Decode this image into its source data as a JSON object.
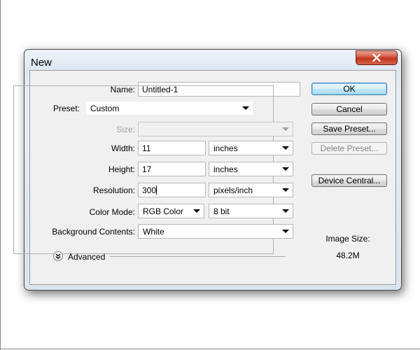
{
  "dialog": {
    "title": "New",
    "fields": {
      "name_label": "Name:",
      "name_value": "Untitled-1",
      "preset_label": "Preset:",
      "preset_value": "Custom",
      "size_label": "Size:",
      "size_value": "",
      "width_label": "Width:",
      "width_value": "11",
      "width_unit": "inches",
      "height_label": "Height:",
      "height_value": "17",
      "height_unit": "inches",
      "resolution_label": "Resolution:",
      "resolution_value": "300",
      "resolution_unit": "pixels/inch",
      "color_mode_label": "Color Mode:",
      "color_mode_value": "RGB Color",
      "bit_depth_value": "8 bit",
      "background_label": "Background Contents:",
      "background_value": "White",
      "advanced_label": "Advanced"
    },
    "buttons": {
      "ok": "OK",
      "cancel": "Cancel",
      "save_preset": "Save Preset...",
      "delete_preset": "Delete Preset...",
      "device_central": "Device Central..."
    },
    "image_size": {
      "label": "Image Size:",
      "value": "48.2M"
    }
  },
  "colors": {
    "close_button": "#c7432b",
    "default_button_border": "#3c7fb1"
  },
  "icons": {
    "close": "close-icon",
    "dropdown": "chevron-down-icon",
    "advanced": "double-chevron-down-icon"
  }
}
